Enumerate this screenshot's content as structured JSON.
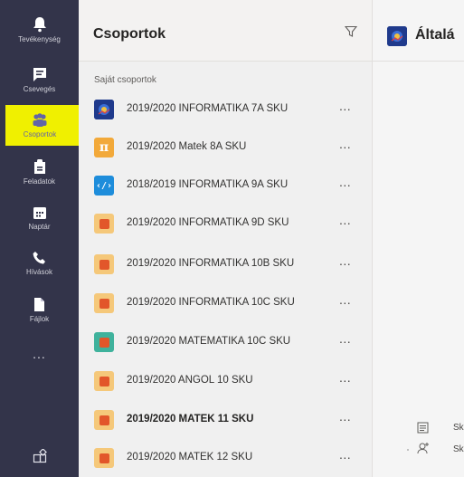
{
  "rail": {
    "items": [
      {
        "label": "Tevékenység",
        "icon": "bell-icon"
      },
      {
        "label": "Csevegés",
        "icon": "chat-icon"
      },
      {
        "label": "Csoportok",
        "icon": "teams-icon",
        "active": true
      },
      {
        "label": "Feladatok",
        "icon": "assignments-icon"
      },
      {
        "label": "Naptár",
        "icon": "calendar-icon"
      },
      {
        "label": "Hívások",
        "icon": "phone-icon"
      },
      {
        "label": "Fájlok",
        "icon": "file-icon"
      }
    ],
    "more": "...",
    "store_icon": "apps-icon",
    "highlight_color": "#f0f000",
    "bg_color": "#33344a"
  },
  "list": {
    "title": "Csoportok",
    "section": "Saját csoportok",
    "more_label": "...",
    "teams": [
      {
        "name": "2019/2020 INFORMATIKA 7A SKU",
        "avatar": "photo"
      },
      {
        "name": "2019/2020 Matek 8A SKU",
        "avatar": "pi",
        "glyph": "π"
      },
      {
        "name": "2018/2019 INFORMATIKA 9A SKU",
        "avatar": "code",
        "glyph": "‹/›"
      },
      {
        "name": "2019/2020 INFORMATIKA 9D SKU",
        "avatar": "orange"
      },
      {
        "name": "2019/2020 INFORMATIKA 10B SKU",
        "avatar": "orange"
      },
      {
        "name": "2019/2020 INFORMATIKA 10C SKU",
        "avatar": "orange"
      },
      {
        "name": "2019/2020 MATEMATIKA 10C SKU",
        "avatar": "green"
      },
      {
        "name": "2019/2020 ANGOL 10 SKU",
        "avatar": "orange"
      },
      {
        "name": "2019/2020 MATEK 11 SKU",
        "avatar": "orange",
        "bold": true
      },
      {
        "name": "2019/2020 MATEK 12 SKU",
        "avatar": "orange"
      }
    ]
  },
  "pane": {
    "title": "Általá",
    "line1": "Sk",
    "line2": "Sk"
  }
}
